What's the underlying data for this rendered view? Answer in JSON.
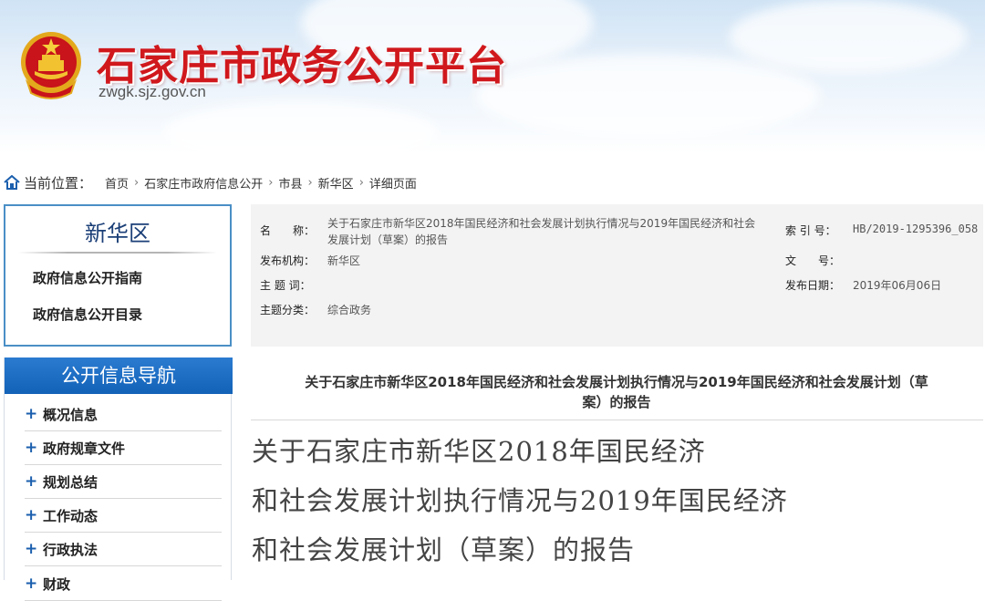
{
  "banner": {
    "site_title": "石家庄市政务公开平台",
    "site_domain": "zwgk.sjz.gov.cn",
    "emblem_icon": "national-emblem-icon",
    "title_color": "#d0181c"
  },
  "breadcrumb": {
    "label": "当前位置：",
    "home_icon": "home-icon",
    "items": [
      "首页",
      "石家庄市政府信息公开",
      "市县",
      "新华区",
      "详细页面"
    ]
  },
  "district": {
    "title": "新华区",
    "links": [
      "政府信息公开指南",
      "政府信息公开目录"
    ]
  },
  "nav": {
    "header": "公开信息导航",
    "header_color": "#1b6ac2",
    "items": [
      "概况信息",
      "政府规章文件",
      "规划总结",
      "工作动态",
      "行政执法",
      "财政"
    ]
  },
  "meta": {
    "name_label": "名　　称：",
    "name_value_line1": "关于石家庄市新华区2018年国民经济和社会发展计划执行情况与2019年国民经济和社会",
    "name_value_line2": "发展计划（草案）的报告",
    "index_label": "索 引 号：",
    "index_value": "HB/2019-1295396_058",
    "publisher_label": "发布机构：",
    "publisher_value": "新华区",
    "doc_no_label": "文　　号：",
    "doc_no_value": "",
    "subject_label": "主 题 词：",
    "subject_value": "",
    "date_label": "发布日期：",
    "date_value": "2019年06月06日",
    "category_label": "主题分类：",
    "category_value": "综合政务"
  },
  "article": {
    "header_line1": "关于石家庄市新华区2018年国民经济和社会发展计划执行情况与2019年国民经济和社会发展计划（草",
    "header_line2": "案）的报告",
    "title_lines": [
      "关于石家庄市新华区2018年国民经济",
      "和社会发展计划执行情况与2019年国民经济",
      "和社会发展计划（草案）的报告"
    ]
  }
}
